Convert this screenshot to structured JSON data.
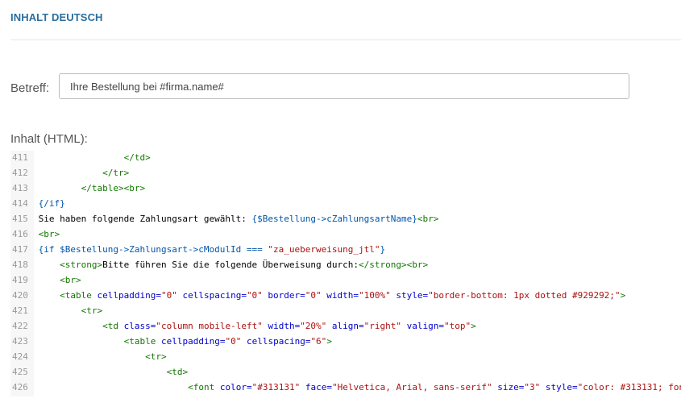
{
  "section": {
    "title": "INHALT DEUTSCH"
  },
  "betreff": {
    "label": "Betreff:",
    "value": "Ihre Bestellung bei #firma.name#"
  },
  "inhalt": {
    "label": "Inhalt (HTML):"
  },
  "editor": {
    "lines": [
      {
        "num": "411",
        "indent": 4,
        "tokens": [
          {
            "t": "</td>",
            "c": "tag"
          }
        ]
      },
      {
        "num": "412",
        "indent": 3,
        "tokens": [
          {
            "t": "</tr>",
            "c": "tag"
          }
        ]
      },
      {
        "num": "413",
        "indent": 2,
        "tokens": [
          {
            "t": "</table><br>",
            "c": "tag"
          }
        ]
      },
      {
        "num": "414",
        "indent": 0,
        "tokens": [
          {
            "t": "{/if}",
            "c": "tpl"
          }
        ]
      },
      {
        "num": "415",
        "indent": 0,
        "tokens": [
          {
            "t": "Sie haben folgende Zahlungsart gewählt: ",
            "c": "code"
          },
          {
            "t": "{$Bestellung->cZahlungsartName}",
            "c": "tpl"
          },
          {
            "t": "<br>",
            "c": "tag"
          }
        ]
      },
      {
        "num": "416",
        "indent": 0,
        "tokens": [
          {
            "t": "<br>",
            "c": "tag"
          }
        ]
      },
      {
        "num": "417",
        "indent": 0,
        "tokens": [
          {
            "t": "{if $Bestellung->Zahlungsart->cModulId === ",
            "c": "tpl"
          },
          {
            "t": "\"za_ueberweisung_jtl\"",
            "c": "str"
          },
          {
            "t": "}",
            "c": "tpl"
          }
        ]
      },
      {
        "num": "418",
        "indent": 1,
        "tokens": [
          {
            "t": "<strong>",
            "c": "tag"
          },
          {
            "t": "Bitte führen Sie die folgende Überweisung durch:",
            "c": "code"
          },
          {
            "t": "</strong><br>",
            "c": "tag"
          }
        ]
      },
      {
        "num": "419",
        "indent": 1,
        "tokens": [
          {
            "t": "<br>",
            "c": "tag"
          }
        ]
      },
      {
        "num": "420",
        "indent": 1,
        "tokens": [
          {
            "t": "<table ",
            "c": "tag"
          },
          {
            "t": "cellpadding=",
            "c": "attr"
          },
          {
            "t": "\"0\"",
            "c": "str"
          },
          {
            "t": " cellspacing=",
            "c": "attr"
          },
          {
            "t": "\"0\"",
            "c": "str"
          },
          {
            "t": " border=",
            "c": "attr"
          },
          {
            "t": "\"0\"",
            "c": "str"
          },
          {
            "t": " width=",
            "c": "attr"
          },
          {
            "t": "\"100%\"",
            "c": "str"
          },
          {
            "t": " style=",
            "c": "attr"
          },
          {
            "t": "\"border-bottom: 1px dotted #929292;\"",
            "c": "str"
          },
          {
            "t": ">",
            "c": "tag"
          }
        ]
      },
      {
        "num": "421",
        "indent": 2,
        "tokens": [
          {
            "t": "<tr>",
            "c": "tag"
          }
        ]
      },
      {
        "num": "422",
        "indent": 3,
        "tokens": [
          {
            "t": "<td ",
            "c": "tag"
          },
          {
            "t": "class=",
            "c": "attr"
          },
          {
            "t": "\"column mobile-left\"",
            "c": "str"
          },
          {
            "t": " width=",
            "c": "attr"
          },
          {
            "t": "\"20%\"",
            "c": "str"
          },
          {
            "t": " align=",
            "c": "attr"
          },
          {
            "t": "\"right\"",
            "c": "str"
          },
          {
            "t": " valign=",
            "c": "attr"
          },
          {
            "t": "\"top\"",
            "c": "str"
          },
          {
            "t": ">",
            "c": "tag"
          }
        ]
      },
      {
        "num": "423",
        "indent": 4,
        "tokens": [
          {
            "t": "<table ",
            "c": "tag"
          },
          {
            "t": "cellpadding=",
            "c": "attr"
          },
          {
            "t": "\"0\"",
            "c": "str"
          },
          {
            "t": " cellspacing=",
            "c": "attr"
          },
          {
            "t": "\"6\"",
            "c": "str"
          },
          {
            "t": ">",
            "c": "tag"
          }
        ]
      },
      {
        "num": "424",
        "indent": 5,
        "tokens": [
          {
            "t": "<tr>",
            "c": "tag"
          }
        ]
      },
      {
        "num": "425",
        "indent": 6,
        "tokens": [
          {
            "t": "<td>",
            "c": "tag"
          }
        ]
      },
      {
        "num": "426",
        "indent": 7,
        "tokens": [
          {
            "t": "<font ",
            "c": "tag"
          },
          {
            "t": "color=",
            "c": "attr"
          },
          {
            "t": "\"#313131\"",
            "c": "str"
          },
          {
            "t": " face=",
            "c": "attr"
          },
          {
            "t": "\"Helvetica, Arial, sans-serif\"",
            "c": "str"
          },
          {
            "t": " size=",
            "c": "attr"
          },
          {
            "t": "\"3\"",
            "c": "str"
          },
          {
            "t": " style=",
            "c": "attr"
          },
          {
            "t": "\"color: #313131; fon",
            "c": "str"
          }
        ]
      }
    ]
  }
}
